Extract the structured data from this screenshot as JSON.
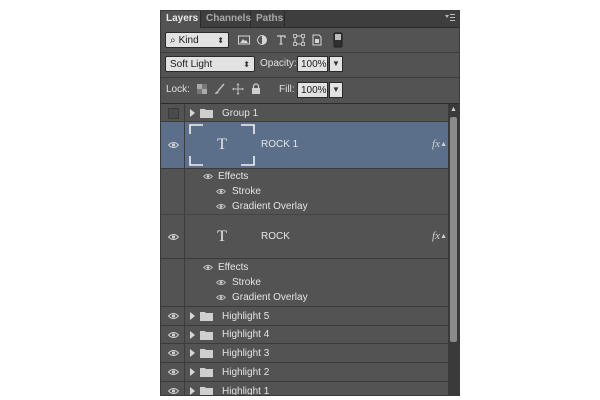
{
  "tabs": [
    {
      "label": "Layers",
      "active": true
    },
    {
      "label": "Channels",
      "active": false
    },
    {
      "label": "Paths",
      "active": false
    }
  ],
  "filter": {
    "kind_label": "Kind",
    "icons": [
      "image-filter-icon",
      "adjustment-filter-icon",
      "type-filter-icon",
      "shape-filter-icon",
      "smart-object-filter-icon",
      "filter-toggle-icon"
    ]
  },
  "blend": {
    "mode": "Soft Light",
    "opacity_label": "Opacity:",
    "opacity_value": "100%"
  },
  "lock": {
    "label": "Lock:",
    "icons": [
      "lock-transparent-icon",
      "lock-paint-icon",
      "lock-move-icon",
      "lock-all-icon"
    ],
    "fill_label": "Fill:",
    "fill_value": "100%"
  },
  "layers": {
    "group1": {
      "name": "Group 1"
    },
    "rock1": {
      "name": "ROCK 1",
      "thumb": "T",
      "fx": "fx"
    },
    "rock1_effects": {
      "label": "Effects",
      "items": [
        "Stroke",
        "Gradient Overlay"
      ]
    },
    "rock": {
      "name": "ROCK",
      "thumb": "T",
      "fx": "fx"
    },
    "rock_effects": {
      "label": "Effects",
      "items": [
        "Stroke",
        "Gradient Overlay"
      ]
    },
    "groups": [
      "Highlight 5",
      "Highlight 4",
      "Highlight 3",
      "Highlight 2",
      "Highlight 1"
    ]
  },
  "colors": {
    "panel_bg": "#535353",
    "selected_row": "#5c6f8a"
  }
}
